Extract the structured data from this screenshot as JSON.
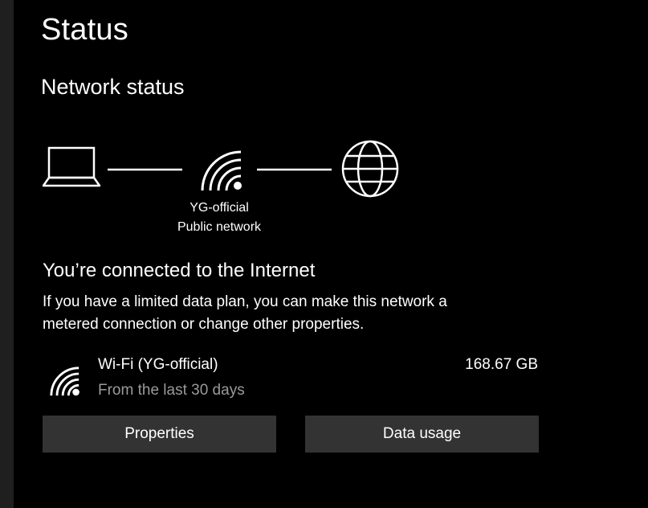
{
  "header": {
    "title": "Status"
  },
  "network_status": {
    "section_title": "Network status",
    "network_name": "YG-official",
    "network_type": "Public network",
    "icons": [
      "laptop-icon",
      "wifi-icon",
      "globe-icon"
    ]
  },
  "connection": {
    "headline": "You’re connected to the Internet",
    "description_line1": "If you have a limited data plan, you can make this network a",
    "description_line2": "metered connection or change other properties.",
    "adapter_name": "Wi-Fi (YG-official)",
    "adapter_period": "From the last 30 days",
    "data_used": "168.67 GB"
  },
  "buttons": {
    "properties_label": "Properties",
    "data_usage_label": "Data usage"
  },
  "colors": {
    "background": "#000000",
    "text": "#ffffff",
    "secondary_text": "#9a9a9a",
    "button_bg": "#333333",
    "left_strip": "#1f1f1f"
  }
}
